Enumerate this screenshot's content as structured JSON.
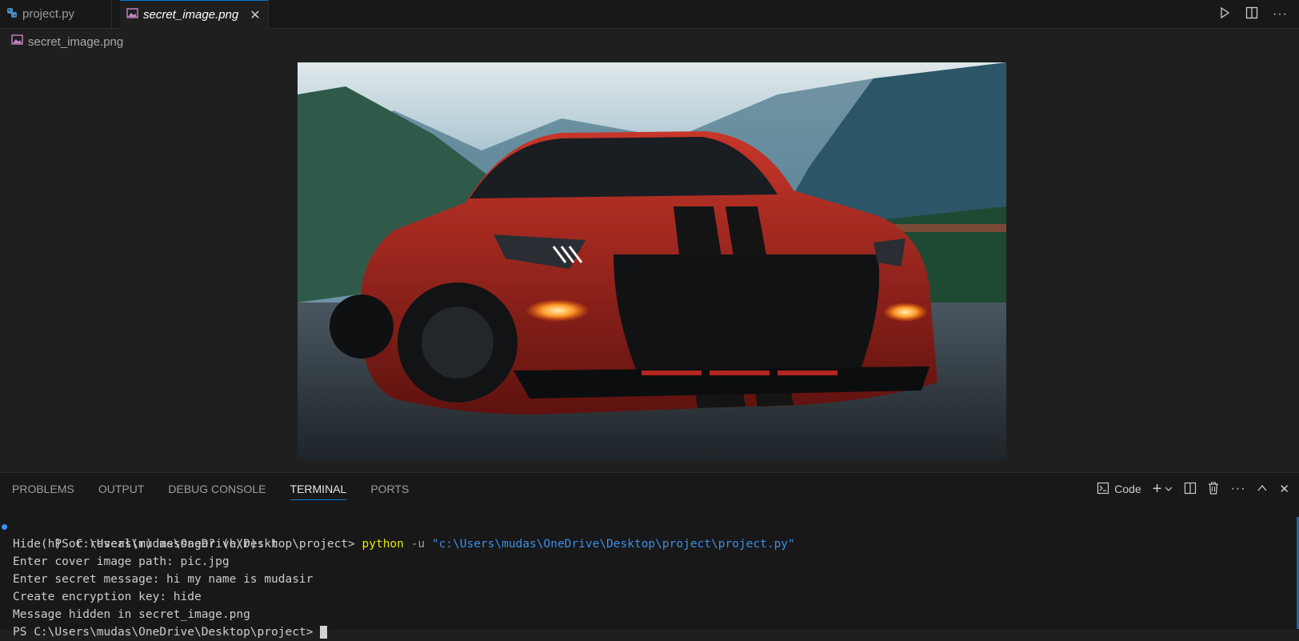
{
  "tabs": [
    {
      "label": "project.py",
      "icon": "python-icon",
      "active": false
    },
    {
      "label": "secret_image.png",
      "icon": "image-file-icon",
      "active": true
    }
  ],
  "breadcrumb": {
    "label": "secret_image.png"
  },
  "panel": {
    "tabs": [
      "PROBLEMS",
      "OUTPUT",
      "DEBUG CONSOLE",
      "TERMINAL",
      "PORTS"
    ],
    "active_tab": "TERMINAL",
    "shell_label": "Code"
  },
  "terminal": {
    "prompt": "PS C:\\Users\\mudas\\OneDrive\\Desktop\\project> ",
    "command": "python",
    "flag": " -u ",
    "arg": "\"c:\\Users\\mudas\\OneDrive\\Desktop\\project\\project.py\"",
    "lines": [
      "Hide(h) or reveal(r) message? (h/r): h",
      "Enter cover image path: pic.jpg",
      "Enter secret message: hi my name is mudasir",
      "Create encryption key: hide",
      "Message hidden in secret_image.png"
    ],
    "last_prompt": "PS C:\\Users\\mudas\\OneDrive\\Desktop\\project> "
  },
  "colors": {
    "accent": "#0078d4",
    "terminal_command": "#e5e510",
    "terminal_string": "#3b8eea",
    "car_red": "#b3261e"
  }
}
